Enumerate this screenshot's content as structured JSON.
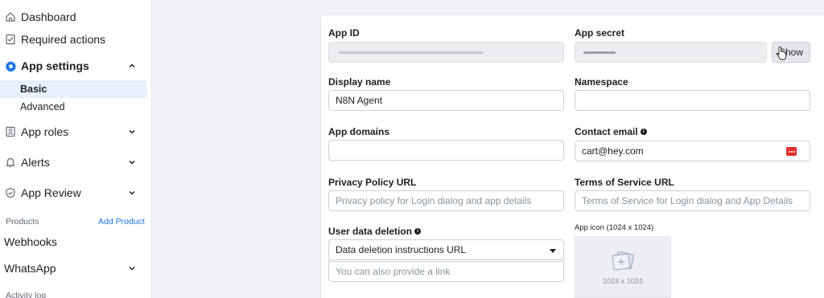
{
  "sidebar": {
    "dashboard": "Dashboard",
    "required_actions": "Required actions",
    "app_settings": "App settings",
    "basic": "Basic",
    "advanced": "Advanced",
    "app_roles": "App roles",
    "alerts": "Alerts",
    "app_review": "App Review",
    "products_label": "Products",
    "add_product": "Add Product",
    "webhooks": "Webhooks",
    "whatsapp": "WhatsApp",
    "activity_log": "Activity log"
  },
  "form": {
    "app_id_label": "App ID",
    "app_secret_label": "App secret",
    "show_button": "Show",
    "display_name_label": "Display name",
    "display_name_value": "N8N Agent",
    "namespace_label": "Namespace",
    "namespace_value": "",
    "app_domains_label": "App domains",
    "app_domains_value": "",
    "contact_email_label": "Contact email",
    "contact_email_value": "cart@hey.com",
    "privacy_label": "Privacy Policy URL",
    "privacy_placeholder": "Privacy policy for Login dialog and app details",
    "tos_label": "Terms of Service URL",
    "tos_placeholder": "Terms of Service for Login dialog and App Details",
    "user_data_deletion_label": "User data deletion",
    "user_data_deletion_selected": "Data deletion instructions URL",
    "link_placeholder": "You can also provide a link",
    "app_icon_label": "App icon (1024 x 1024)",
    "app_icon_dim": "1024 x 1024"
  },
  "colors": {
    "accent": "#1b74e4",
    "active_bg": "#e7f0fd",
    "page_bg": "#f0f2f5"
  }
}
